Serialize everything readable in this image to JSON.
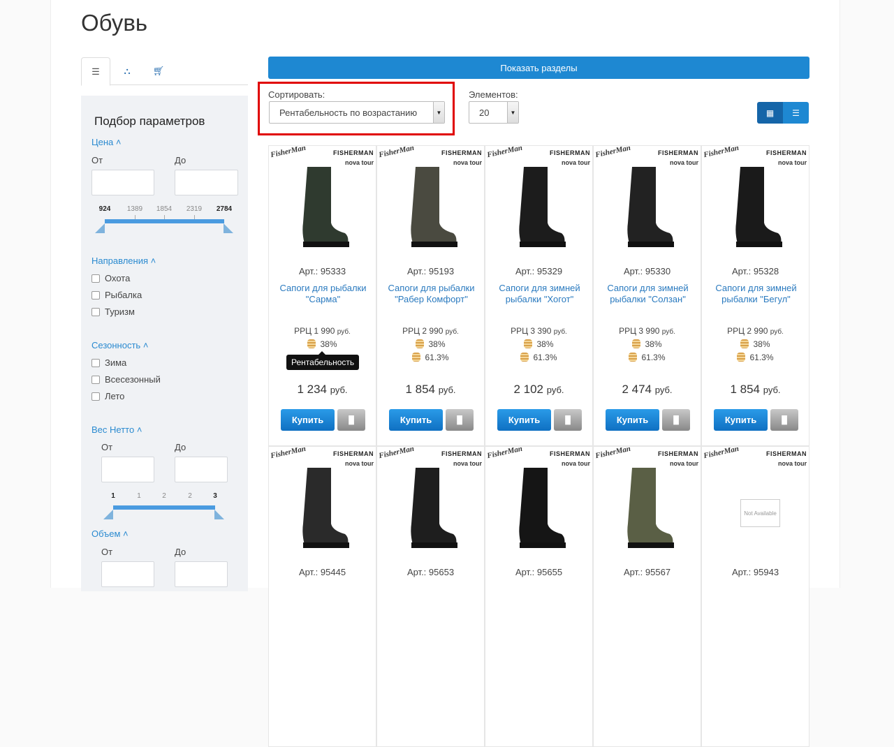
{
  "page_title": "Обувь",
  "sidebar": {
    "tabs": [
      {
        "icon": "sliders-icon"
      },
      {
        "icon": "sitemap-icon"
      },
      {
        "icon": "cart-icon"
      }
    ],
    "title": "Подбор параметров",
    "price": {
      "label": "Цена",
      "from_label": "От",
      "to_label": "До",
      "ticks": [
        "924",
        "1389",
        "1854",
        "2319",
        "2784"
      ]
    },
    "directions": {
      "label": "Направления",
      "items": [
        "Охота",
        "Рыбалка",
        "Туризм"
      ]
    },
    "season": {
      "label": "Сезонность",
      "items": [
        "Зима",
        "Всесезонный",
        "Лето"
      ]
    },
    "weight": {
      "label": "Вес Нетто",
      "from_label": "От",
      "to_label": "До",
      "ticks": [
        "1",
        "1",
        "2",
        "2",
        "3"
      ]
    },
    "volume": {
      "label": "Объем",
      "from_label": "От",
      "to_label": "До"
    }
  },
  "toolbar": {
    "show_sections": "Показать разделы",
    "sort_label": "Сортировать:",
    "sort_value": "Рентабельность по возрастанию",
    "count_label": "Элементов:",
    "count_value": "20",
    "view_grid_icon": "grid-icon",
    "view_list_icon": "list-icon"
  },
  "accent": "#1e88d2",
  "card_common": {
    "brand": "FISHERMAN",
    "brand_sub": "nova tour",
    "logo": "FisherMan",
    "buy": "Купить",
    "rrc_prefix": "РРЦ",
    "currency": "руб.",
    "tooltip": "Рентабельность"
  },
  "products": [
    {
      "art": "Арт.: 95333",
      "name": "Сапоги для рыбалки \"Сарма\"",
      "rrc": "1 990",
      "p1": "38%",
      "p2": "61.3%",
      "price": "1 234",
      "color": "#2f3a2f"
    },
    {
      "art": "Арт.: 95193",
      "name": "Сапоги для рыбалки \"Рабер Комфорт\"",
      "rrc": "2 990",
      "p1": "38%",
      "p2": "61.3%",
      "price": "1 854",
      "color": "#4a4a40"
    },
    {
      "art": "Арт.: 95329",
      "name": "Сапоги для зимней рыбалки \"Хогот\"",
      "rrc": "3 390",
      "p1": "38%",
      "p2": "61.3%",
      "price": "2 102",
      "color": "#1c1c1c"
    },
    {
      "art": "Арт.: 95330",
      "name": "Сапоги для зимней рыбалки \"Солзан\"",
      "rrc": "3 990",
      "p1": "38%",
      "p2": "61.3%",
      "price": "2 474",
      "color": "#222"
    },
    {
      "art": "Арт.: 95328",
      "name": "Сапоги для зимней рыбалки \"Бегул\"",
      "rrc": "2 990",
      "p1": "38%",
      "p2": "61.3%",
      "price": "1 854",
      "color": "#1a1a1a"
    },
    {
      "art": "Арт.: 95445",
      "color": "#2a2a2a"
    },
    {
      "art": "Арт.: 95653",
      "color": "#1e1e1e"
    },
    {
      "art": "Арт.: 95655",
      "color": "#151515"
    },
    {
      "art": "Арт.: 95567",
      "color": "#5a5f45"
    },
    {
      "art": "Арт.: 95943",
      "not_available": "Not Available"
    }
  ]
}
